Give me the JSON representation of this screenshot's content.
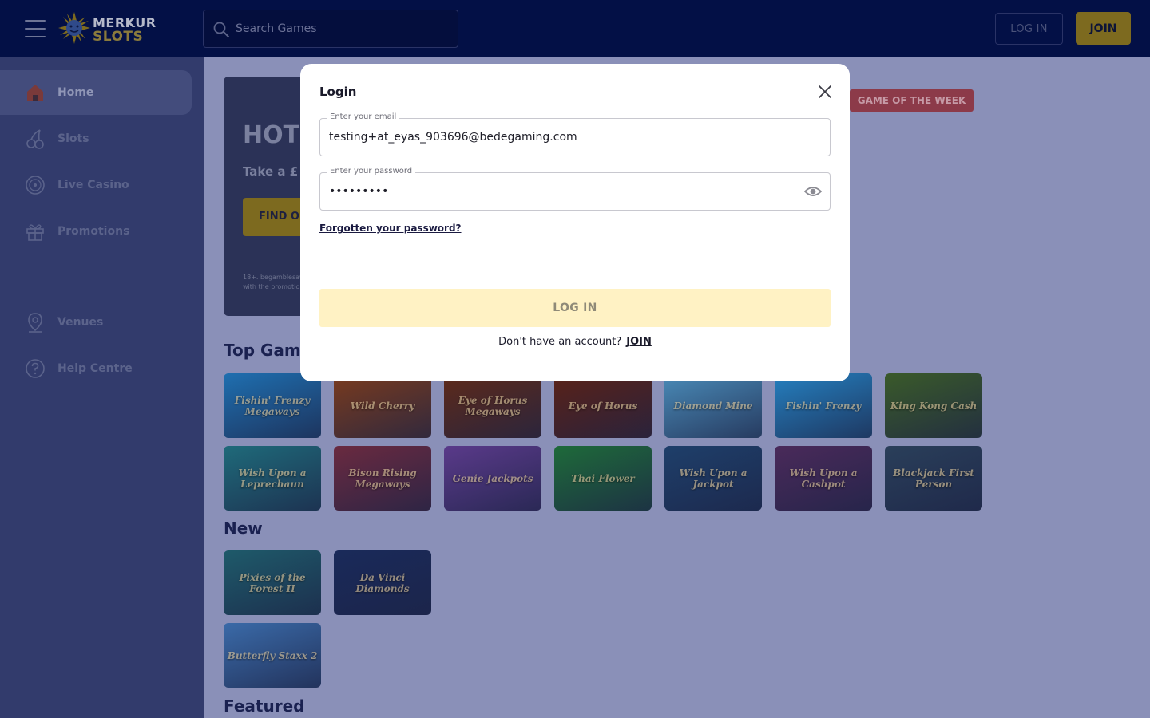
{
  "header": {
    "logo_line1": "MERKUR",
    "logo_line2": "SLOTS",
    "search_placeholder": "Search Games",
    "login_label": "LOG IN",
    "join_label": "JOIN"
  },
  "sidebar": {
    "items": [
      {
        "label": "Home",
        "icon": "house-icon",
        "active": true
      },
      {
        "label": "Slots",
        "icon": "cherries-icon"
      },
      {
        "label": "Live Casino",
        "icon": "roulette-wheel-icon"
      },
      {
        "label": "Promotions",
        "icon": "gift-icon"
      },
      {
        "label": "Venues",
        "icon": "map-pin-icon"
      },
      {
        "label": "Help Centre",
        "icon": "help-circle-icon"
      }
    ]
  },
  "main": {
    "hero": {
      "title": "HOT",
      "subtitle": "Take a £",
      "cta": "FIND O",
      "small_print": "18+. begamblesaw with the promotio"
    },
    "badge": "GAME OF THE WEEK",
    "sections": {
      "top_games": "Top Game",
      "new": "New",
      "featured": "Featured"
    },
    "top_games": [
      {
        "name": "Fishin' Frenzy Megaways",
        "color": "#1f6fb0"
      },
      {
        "name": "Wild Cherry",
        "color": "#7a3b1e"
      },
      {
        "name": "Eye of Horus Megaways",
        "color": "#5e2a1a"
      },
      {
        "name": "Eye of Horus",
        "color": "#5a2218"
      },
      {
        "name": "Diamond Mine",
        "color": "#4a8bb8"
      },
      {
        "name": "Fishin' Frenzy",
        "color": "#2580c0"
      },
      {
        "name": "King Kong Cash",
        "color": "#3a5a2a"
      },
      {
        "name": "Wish Upon a Leprechaun",
        "color": "#1f6a7a"
      },
      {
        "name": "Bison Rising Megaways",
        "color": "#6a2a40"
      },
      {
        "name": "Genie Jackpots",
        "color": "#5a3a8a"
      },
      {
        "name": "Thai Flower",
        "color": "#1e6a3a"
      },
      {
        "name": "Wish Upon a Jackpot",
        "color": "#1e3f6a"
      },
      {
        "name": "Wish Upon a Cashpot",
        "color": "#4a2a5a"
      },
      {
        "name": "Blackjack First Person",
        "color": "#2a3f5a"
      }
    ],
    "new_games": [
      {
        "name": "Pixies of the Forest II",
        "color": "#1e5a6a"
      },
      {
        "name": "Da Vinci Diamonds",
        "color": "#1a2a5a"
      },
      {
        "name": "Butterfly Staxx 2",
        "color": "#3a6aa8"
      }
    ]
  },
  "modal": {
    "title": "Login",
    "email_label": "Enter your email",
    "email_value": "testing+at_eyas_903696@bedegaming.com",
    "password_label": "Enter your password",
    "password_value": "•••••••••",
    "forgot_label": "Forgotten your password?",
    "login_label": "LOG IN",
    "no_account_text": "Don't have an account?",
    "join_label": "JOIN"
  },
  "colors": {
    "header_bg": "#031046",
    "sidebar_bg": "#323b6c",
    "overlay_bg": "#8a90b8",
    "accent_gold": "#7d6a1f",
    "login_button_bg": "#fff2c4",
    "badge_bg": "#8c3a49"
  }
}
